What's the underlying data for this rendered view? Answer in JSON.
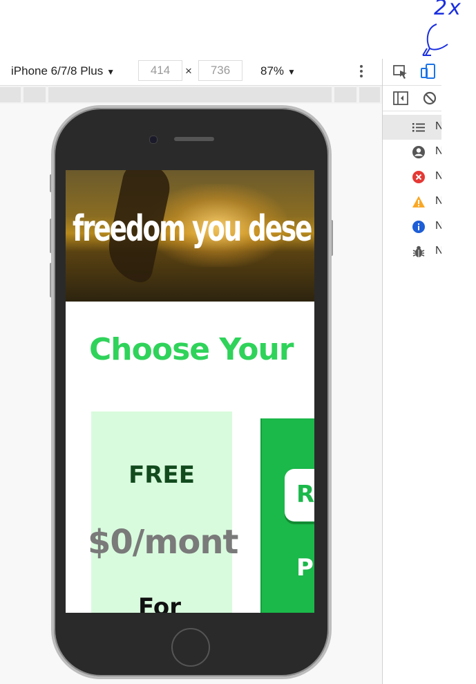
{
  "annotation": {
    "text": "2x"
  },
  "toolbar": {
    "device": "iPhone 6/7/8 Plus",
    "width": "414",
    "height": "736",
    "times": "×",
    "zoom": "87%"
  },
  "sidebar": {
    "items": [
      {
        "icon": "list-icon",
        "label": "N",
        "active": true
      },
      {
        "icon": "user-icon",
        "label": "N"
      },
      {
        "icon": "error-icon",
        "label": "N",
        "color": "#e53935"
      },
      {
        "icon": "warning-icon",
        "label": "N",
        "color": "#f9a825"
      },
      {
        "icon": "info-icon",
        "label": "N",
        "color": "#1e5ed6"
      },
      {
        "icon": "bug-icon",
        "label": "N"
      }
    ]
  },
  "page": {
    "hero_title": "freedom you dese",
    "section_title": "Choose Your",
    "free_card": {
      "title": "FREE",
      "price": "$0/mont",
      "for": "For"
    },
    "pro_card": {
      "badge": "R",
      "label": "P"
    }
  },
  "colors": {
    "accent_green": "#2fd35a",
    "pro_green": "#1bb84a",
    "free_bg": "#d8fbdd",
    "annotation_blue": "#1a2fe0",
    "devtools_blue": "#1a73e8"
  }
}
